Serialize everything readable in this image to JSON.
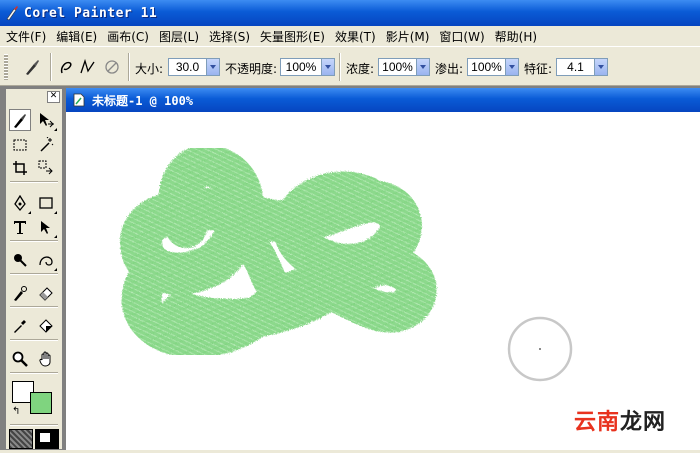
{
  "app": {
    "title": "Corel Painter 11"
  },
  "menu": {
    "items": [
      {
        "label": "文件(F)"
      },
      {
        "label": "编辑(E)"
      },
      {
        "label": "画布(C)"
      },
      {
        "label": "图层(L)"
      },
      {
        "label": "选择(S)"
      },
      {
        "label": "矢量图形(E)"
      },
      {
        "label": "效果(T)"
      },
      {
        "label": "影片(M)"
      },
      {
        "label": "窗口(W)"
      },
      {
        "label": "帮助(H)"
      }
    ]
  },
  "property_bar": {
    "size": {
      "label": "大小:",
      "value": "30.0"
    },
    "opacity": {
      "label": "不透明度:",
      "value": "100%"
    },
    "grain": {
      "label": "浓度:",
      "value": "100%"
    },
    "bleed": {
      "label": "渗出:",
      "value": "100%"
    },
    "feature": {
      "label": "特征:",
      "value": "4.1"
    }
  },
  "document": {
    "title": "未标题-1 @ 100%"
  },
  "colors": {
    "main_color": "#ffffff",
    "additional_color": "#7fd47f",
    "stroke_color": "#7fd47f",
    "title_gradient": "#0a5bd6"
  },
  "watermark": {
    "part1": "云南",
    "part2": "龙网"
  }
}
